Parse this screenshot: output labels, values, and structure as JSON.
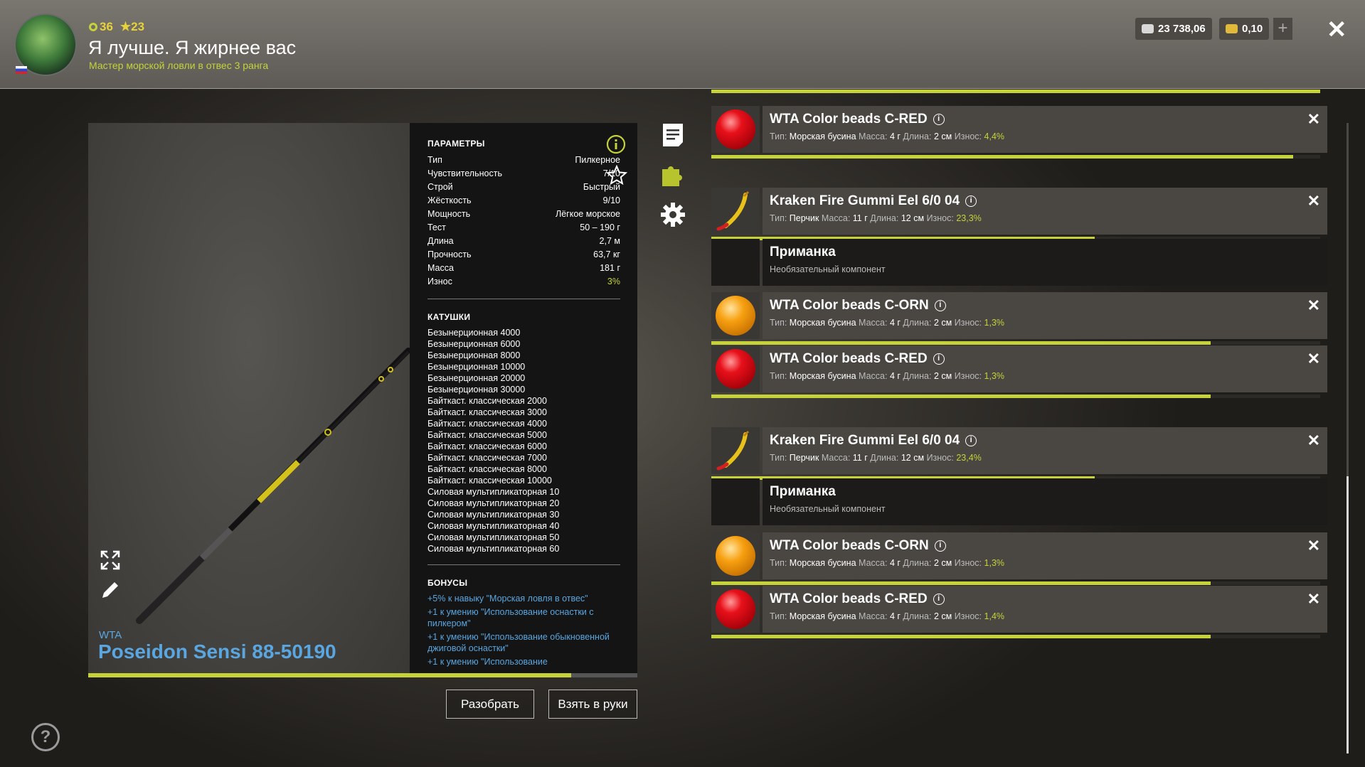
{
  "player": {
    "level": "36",
    "stars": "23",
    "nickname": "Я лучше. Я жирнее вас",
    "rank": "Мастер морской ловли в отвес 3 ранга"
  },
  "currency": {
    "silver": "23 738,06",
    "gold": "0,10"
  },
  "rod": {
    "brand": "WTA",
    "name": "Poseidon Sensi 88-50190",
    "wear_fraction": 0.97
  },
  "params": {
    "title": "ПАРАМЕТРЫ",
    "rows": [
      {
        "k": "Тип",
        "v": "Пилкерное"
      },
      {
        "k": "Чувствительность",
        "v": "7/10"
      },
      {
        "k": "Строй",
        "v": "Быстрый"
      },
      {
        "k": "Жёсткость",
        "v": "9/10"
      },
      {
        "k": "Мощность",
        "v": "Лёгкое морское"
      },
      {
        "k": "Тест",
        "v": "50 – 190 г"
      },
      {
        "k": "Длина",
        "v": "2,7 м"
      },
      {
        "k": "Прочность",
        "v": "63,7 кг"
      },
      {
        "k": "Масса",
        "v": "181 г"
      },
      {
        "k": "Износ",
        "v": "3%"
      }
    ],
    "reels_title": "КАТУШКИ",
    "reels": [
      "Безынерционная 4000",
      "Безынерционная 6000",
      "Безынерционная 8000",
      "Безынерционная 10000",
      "Безынерционная 20000",
      "Безынерционная 30000",
      "Байткаст. классическая 2000",
      "Байткаст. классическая 3000",
      "Байткаст. классическая 4000",
      "Байткаст. классическая 5000",
      "Байткаст. классическая 6000",
      "Байткаст. классическая 7000",
      "Байткаст. классическая 8000",
      "Байткаст. классическая 10000",
      "Силовая мультипликаторная 10",
      "Силовая мультипликаторная 20",
      "Силовая мультипликаторная 30",
      "Силовая мультипликаторная 40",
      "Силовая мультипликаторная 50",
      "Силовая мультипликаторная 60"
    ],
    "bonuses_title": "БОНУСЫ",
    "bonuses": [
      "+5% к навыку \"Морская ловля в отвес\"",
      "+1 к умению \"Использование оснастки с пилкером\"",
      "+1 к умению \"Использование обыкновенной джиговой оснастки\"",
      "+1 к умению \"Использование"
    ]
  },
  "buttons": {
    "disassemble": "Разобрать",
    "take": "Взять в руки"
  },
  "labels": {
    "type": "Тип:",
    "mass": "Масса:",
    "length": "Длина:",
    "wear": "Износ:"
  },
  "slots": [
    {
      "kind": "bead",
      "color": "red",
      "name": "WTA Color beads C-RED",
      "type": "Морская бусина",
      "mass": "4 г",
      "length": "2 см",
      "wear": "4,4%",
      "wear_fraction": 0.956
    },
    {
      "kind": "eel",
      "name": "Kraken Fire Gummi Eel 6/0 04",
      "type": "Перчик",
      "mass": "11 г",
      "length": "12 см",
      "wear": "23,3%",
      "wear_fraction": 0.63
    },
    {
      "kind": "empty",
      "name": "Приманка",
      "sub": "Необязательный компонент"
    },
    {
      "kind": "bead",
      "color": "orn",
      "name": "WTA Color beads C-ORN",
      "type": "Морская бусина",
      "mass": "4 г",
      "length": "2 см",
      "wear": "1,3%",
      "wear_fraction": 0.82
    },
    {
      "kind": "bead",
      "color": "red",
      "name": "WTA Color beads C-RED",
      "type": "Морская бусина",
      "mass": "4 г",
      "length": "2 см",
      "wear": "1,3%",
      "wear_fraction": 0.82
    },
    {
      "kind": "eel",
      "name": "Kraken Fire Gummi Eel 6/0 04",
      "type": "Перчик",
      "mass": "11 г",
      "length": "12 см",
      "wear": "23,4%",
      "wear_fraction": 0.63
    },
    {
      "kind": "empty",
      "name": "Приманка",
      "sub": "Необязательный компонент"
    },
    {
      "kind": "bead",
      "color": "orn",
      "name": "WTA Color beads C-ORN",
      "type": "Морская бусина",
      "mass": "4 г",
      "length": "2 см",
      "wear": "1,3%",
      "wear_fraction": 0.82
    },
    {
      "kind": "bead",
      "color": "red",
      "name": "WTA Color beads C-RED",
      "type": "Морская бусина",
      "mass": "4 г",
      "length": "2 см",
      "wear": "1,4%",
      "wear_fraction": 0.82
    }
  ]
}
